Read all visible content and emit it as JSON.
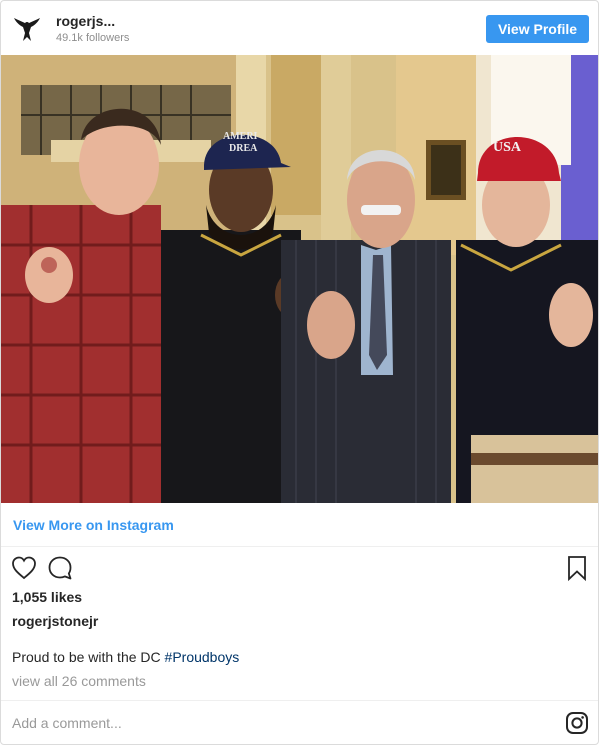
{
  "header": {
    "username": "rogerjs...",
    "followers": "49.1k followers",
    "view_profile_label": "View Profile"
  },
  "post": {
    "image_text": {
      "cap_left": "AMERICAN\nDREAM",
      "cap_left_line1": "AMERI",
      "cap_left_line2": "DREA",
      "cap_right": "USA"
    },
    "view_more_label": "View More on Instagram",
    "likes": "1,055 likes",
    "caption_user": "rogerjstonejr",
    "caption_text": "Proud to be with the DC ",
    "caption_hashtag": "#Proudboys",
    "comments_link": "view all 26 comments",
    "comment_placeholder": "Add a comment..."
  },
  "icons": {
    "avatar": "eagle-logo-icon",
    "like": "heart-icon",
    "comment": "speech-bubble-icon",
    "save": "bookmark-icon",
    "instagram": "instagram-logo-icon"
  },
  "colors": {
    "accent": "#3897f0",
    "hashtag": "#003569",
    "muted": "#8e8e8e"
  }
}
